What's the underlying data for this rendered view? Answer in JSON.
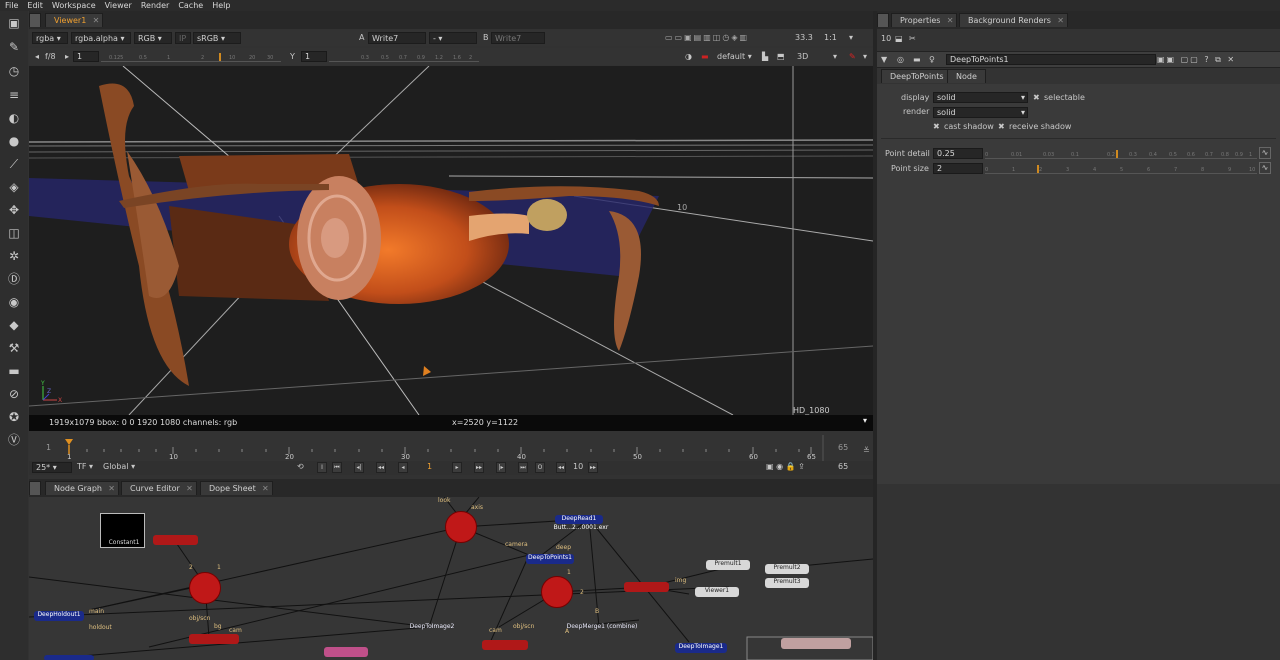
{
  "menu": [
    "File",
    "Edit",
    "Workspace",
    "Viewer",
    "Render",
    "Cache",
    "Help"
  ],
  "viewer": {
    "tab": "Viewer1",
    "channels": "rgba",
    "alpha": "rgba.alpha",
    "color": "RGB",
    "ip": "IP",
    "lut": "sRGB",
    "a_label": "A",
    "a_input": "Write7",
    "mid": "-",
    "b_label": "B",
    "b_input": "Write7",
    "zoom": "33.3",
    "ratio": "1:1",
    "fstop": "f/8",
    "gain": "1",
    "gamma_label": "Y",
    "gamma": "1",
    "gain_ticks": [
      "0.125",
      "0.5",
      "1",
      "2",
      "10",
      "20",
      "30"
    ],
    "gamma_ticks": [
      "0.3",
      "0.5",
      "0.7",
      "0.9",
      "1.2",
      "1.6",
      "2"
    ],
    "view_mode": "default",
    "dim": "3D",
    "grid_label": "10",
    "format": "HD_1080",
    "info": "1919x1079  bbox: 0 0 1920 1080 channels: rgb",
    "coords": "x=2520 y=1122",
    "axis_y": "Y",
    "axis_x": "X",
    "axis_z": "Z"
  },
  "timeline": {
    "start": "1",
    "current": "1",
    "end": "65",
    "ticks": [
      "1",
      "10",
      "20",
      "30",
      "40",
      "50",
      "60",
      "65"
    ],
    "fps": "25*",
    "tf": "TF",
    "global": "Global",
    "step": "10",
    "end_frame": "65"
  },
  "panels": {
    "bottom_tabs": [
      "Node Graph",
      "Curve Editor",
      "Dope Sheet"
    ],
    "right_tabs": [
      "Properties",
      "Background Renders"
    ]
  },
  "nodes": {
    "constant": "Constant1",
    "deepread": "DeepRead1",
    "deepread_file": "Butt...2...0001.exr",
    "deeptopoints": "DeepToPoints1",
    "deepholdout": "DeepHoldout1",
    "deeptoimage2": "DeepToImage2",
    "deepmerge": "DeepMerge1 (combine)",
    "deeptoimage1": "DeepToImage1",
    "premult1": "Premult1",
    "premult2": "Premult2",
    "premult3": "Premult3",
    "viewer1": "Viewer1",
    "camera_label": "camera",
    "deep_label": "deep",
    "look_label": "look",
    "axis_label": "axis",
    "main_label": "main",
    "holdout_label": "holdout",
    "objscn_label": "obj/scn",
    "cam_label": "cam",
    "bg_label": "bg",
    "img_label": "img",
    "a_label": "A",
    "b_label": "B",
    "n1": "1",
    "n2": "2"
  },
  "properties": {
    "count": "10",
    "node_name": "DeepToPoints1",
    "tabs": [
      "DeepToPoints",
      "Node"
    ],
    "display_label": "display",
    "display_value": "solid",
    "selectable_label": "selectable",
    "render_label": "render",
    "render_value": "solid",
    "cast_shadow_label": "cast shadow",
    "receive_shadow_label": "receive shadow",
    "point_detail_label": "Point detail",
    "point_detail_value": "0.25",
    "point_detail_ticks": [
      "0",
      "0.01",
      "0.03",
      "0.1",
      "0.2",
      "0.3",
      "0.4",
      "0.5",
      "0.6",
      "0.7",
      "0.8",
      "0.9",
      "1"
    ],
    "point_size_label": "Point size",
    "point_size_value": "2",
    "point_size_ticks": [
      "0",
      "1",
      "2",
      "3",
      "4",
      "5",
      "6",
      "7",
      "8",
      "9",
      "10"
    ]
  },
  "colors": {
    "accent": "#f0a030",
    "node_red": "#c01818",
    "bg": "#323232"
  }
}
